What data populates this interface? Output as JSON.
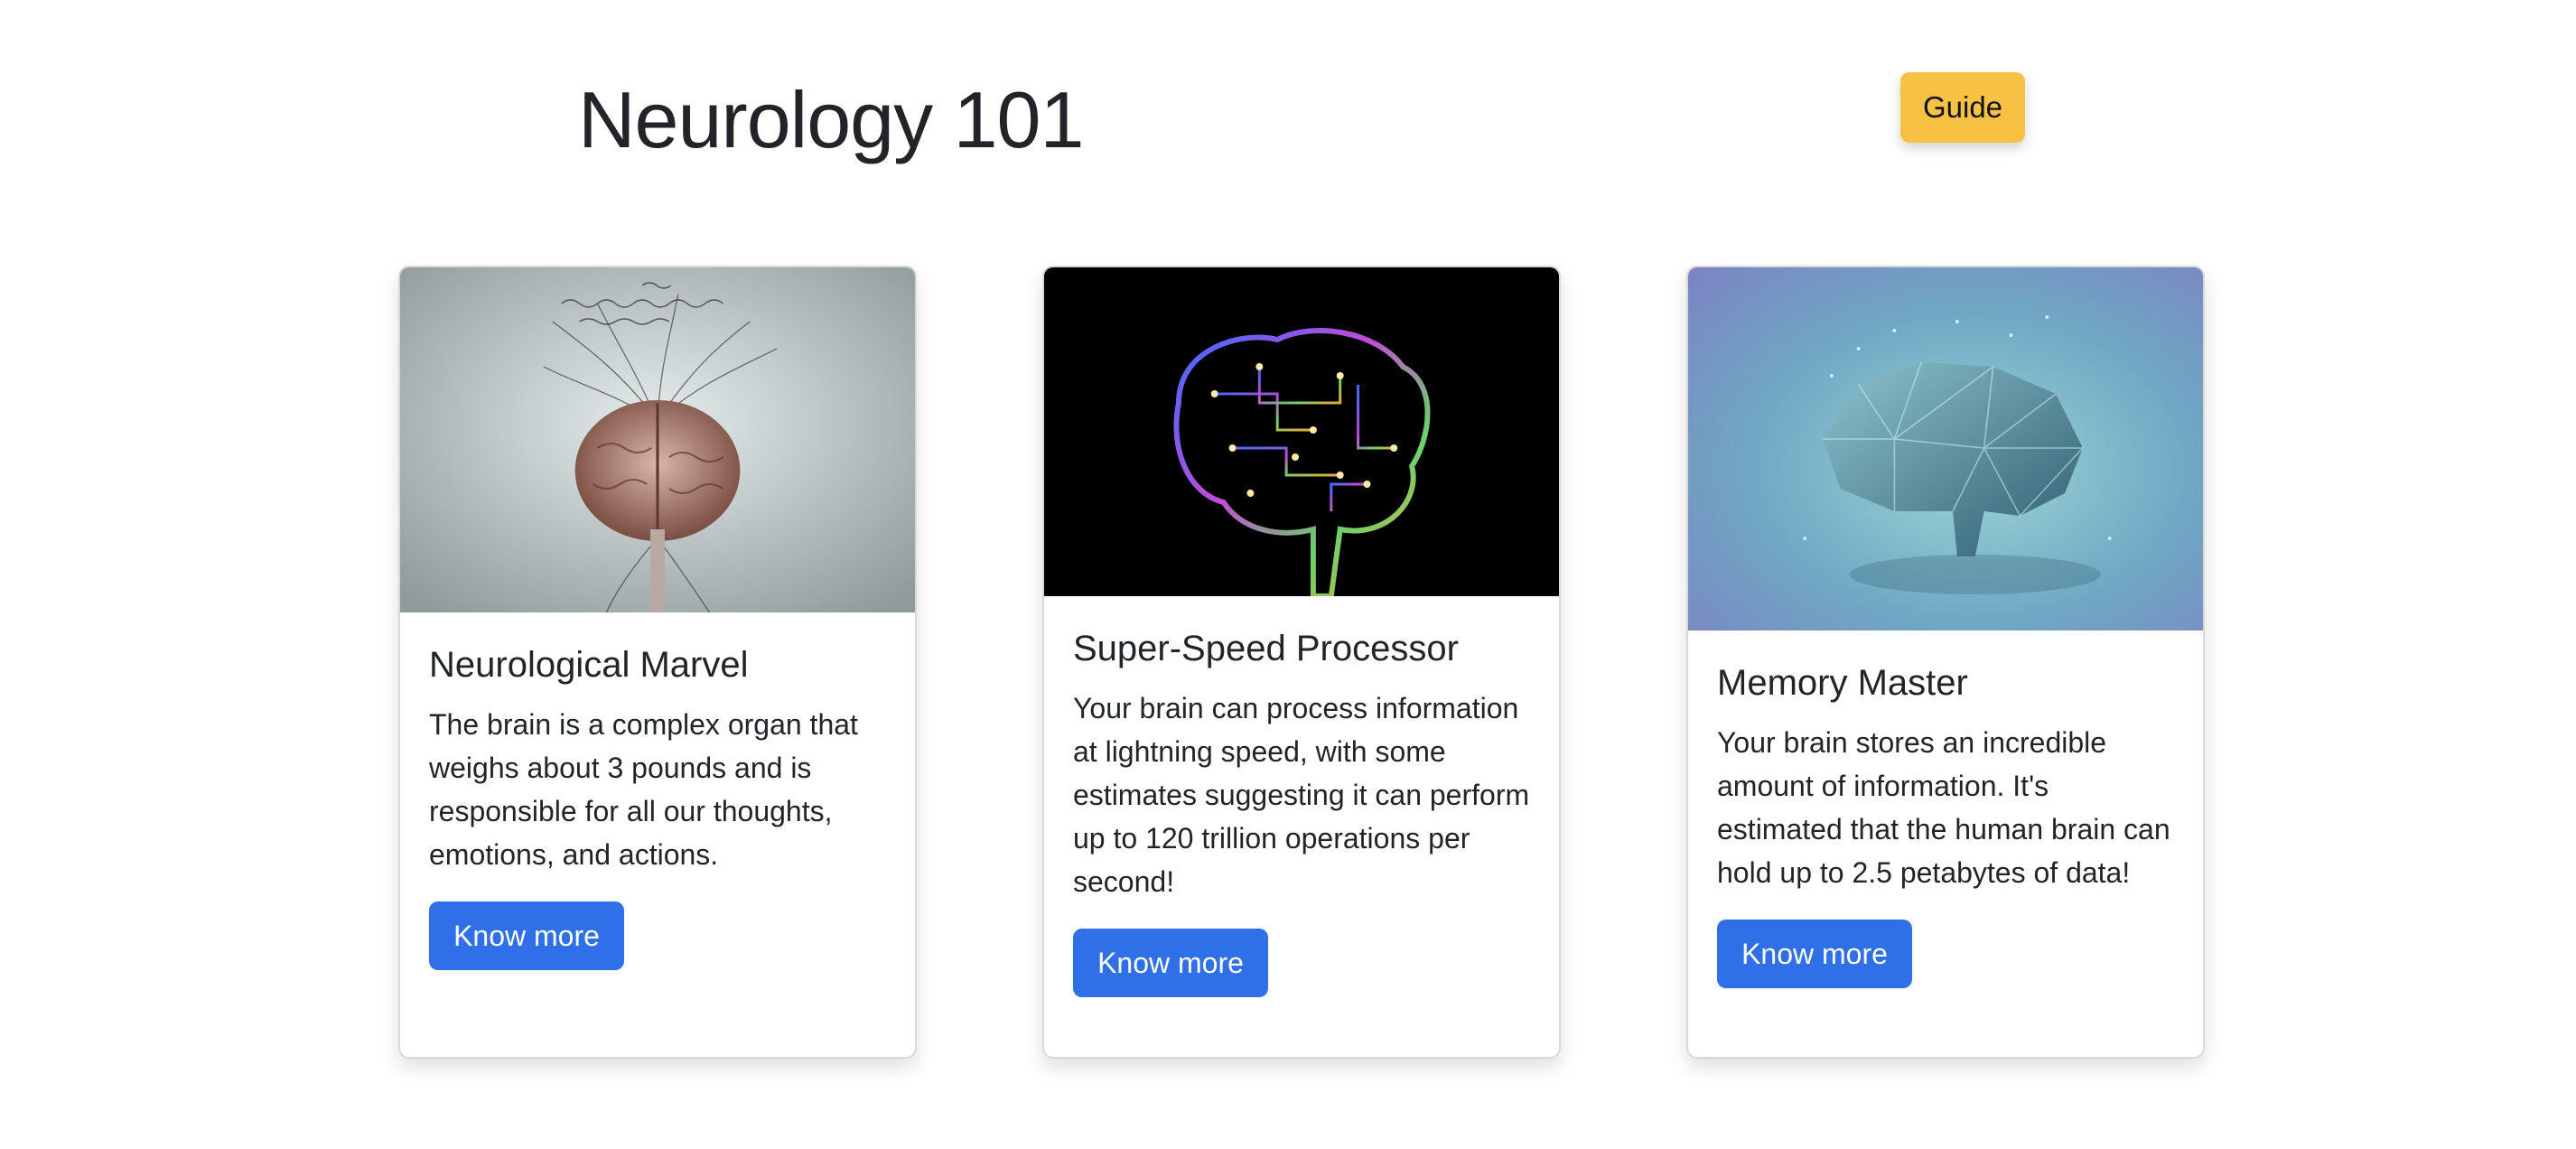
{
  "header": {
    "title": "Neurology 101",
    "guide_label": "Guide"
  },
  "colors": {
    "guide_button": "#f7c244",
    "primary_button": "#2f6fe8"
  },
  "cards": [
    {
      "title": "Neurological Marvel",
      "text": "The brain is a complex organ that weighs about 3 pounds and is responsible for all our thoughts, emotions, and actions.",
      "button_label": "Know more",
      "image": "sketch-brain-with-nerves"
    },
    {
      "title": "Super-Speed Processor",
      "text": "Your brain can process information at lightning speed, with some estimates suggesting it can perform up to 120 trillion operations per second!",
      "button_label": "Know more",
      "image": "circuit-brain"
    },
    {
      "title": "Memory Master",
      "text": "Your brain stores an incredible amount of information. It's estimated that the human brain can hold up to 2.5 petabytes of data!",
      "button_label": "Know more",
      "image": "low-poly-brain"
    }
  ]
}
